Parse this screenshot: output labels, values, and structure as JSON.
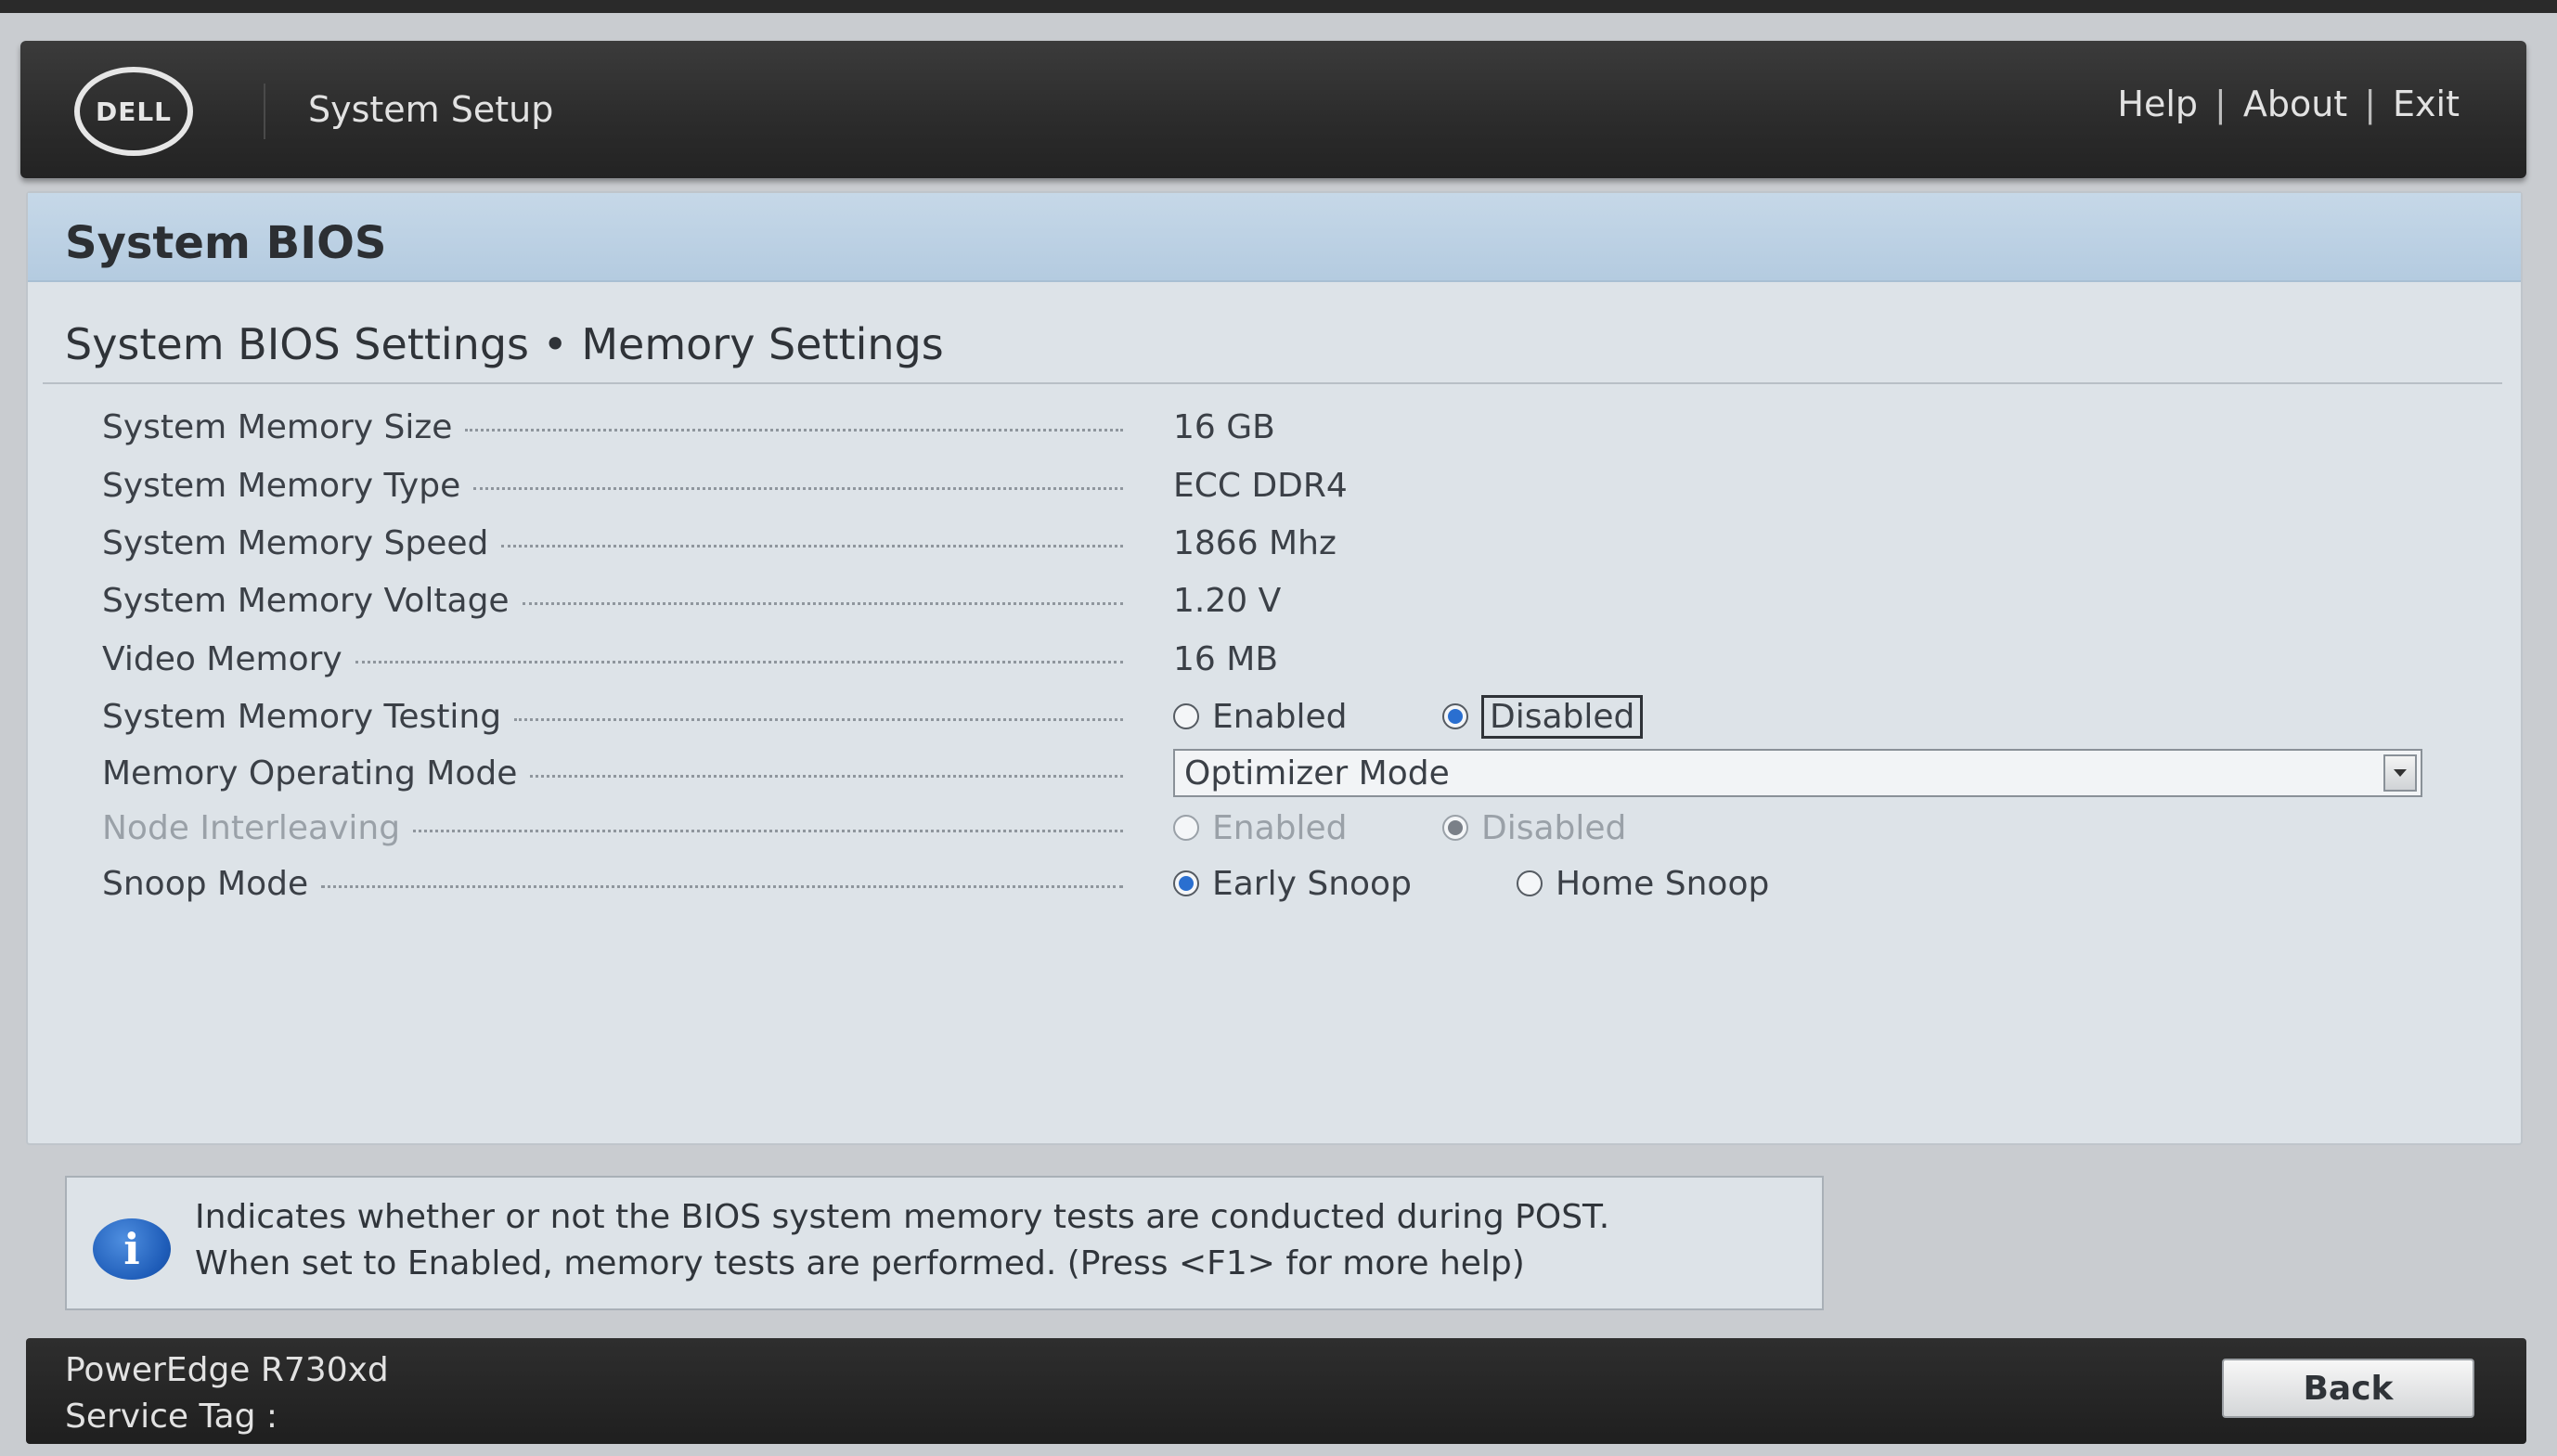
{
  "header": {
    "logo_text": "DELL",
    "app_title": "System Setup",
    "links": [
      "Help",
      "About",
      "Exit"
    ],
    "separator": "|"
  },
  "panel": {
    "title": "System BIOS",
    "section_title": "System BIOS Settings • Memory Settings"
  },
  "settings": {
    "memory_size": {
      "label": "System Memory Size",
      "value": "16 GB"
    },
    "memory_type": {
      "label": "System Memory Type",
      "value": "ECC DDR4"
    },
    "memory_speed": {
      "label": "System Memory Speed",
      "value": "1866 Mhz"
    },
    "memory_voltage": {
      "label": "System Memory Voltage",
      "value": "1.20 V"
    },
    "video_memory": {
      "label": "Video Memory",
      "value": "16 MB"
    },
    "memory_testing": {
      "label": "System Memory Testing",
      "option_a": "Enabled",
      "option_b": "Disabled",
      "selected": "Disabled"
    },
    "operating_mode": {
      "label": "Memory Operating Mode",
      "value": "Optimizer Mode"
    },
    "node_interleaving": {
      "label": "Node Interleaving",
      "option_a": "Enabled",
      "option_b": "Disabled",
      "selected": "Disabled",
      "disabled": true
    },
    "snoop_mode": {
      "label": "Snoop Mode",
      "option_a": "Early Snoop",
      "option_b": "Home Snoop",
      "selected": "Early Snoop"
    }
  },
  "info": {
    "icon": "info-icon",
    "line1": "Indicates whether or not the BIOS system memory tests are conducted during POST.",
    "line2": "When set to Enabled, memory tests are performed. (Press <F1> for more help)"
  },
  "footer": {
    "model": "PowerEdge R730xd",
    "service_tag_label": "Service Tag :",
    "back_label": "Back"
  },
  "colors": {
    "header_bar": "#2b2b2b",
    "panel_header": "#b4cbe0",
    "panel_bg": "#dde3e8",
    "radio_selected": "#2a6fd0"
  }
}
